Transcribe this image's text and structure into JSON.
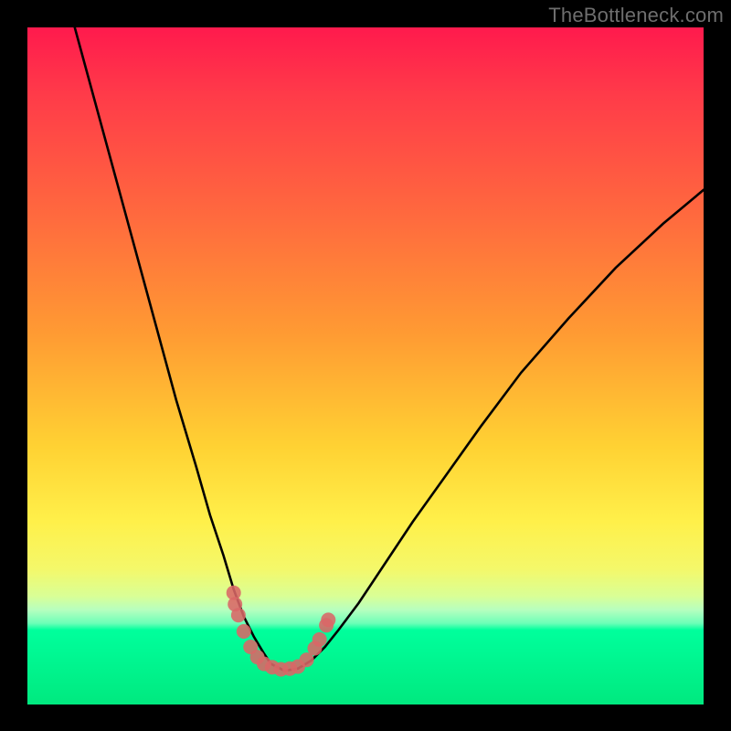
{
  "attribution": "TheBottleneck.com",
  "colors": {
    "frame": "#000000",
    "gradient_top": "#ff1a4d",
    "gradient_mid_orange": "#ff9a33",
    "gradient_yellow": "#fff04a",
    "gradient_green": "#00e97f",
    "curve": "#000000",
    "marker": "#d96666"
  },
  "chart_data": {
    "type": "line",
    "title": "",
    "xlabel": "",
    "ylabel": "",
    "xlim": [
      0,
      100
    ],
    "ylim": [
      0,
      100
    ],
    "series": [
      {
        "name": "curve-left",
        "x": [
          7,
          10,
          13,
          16,
          19,
          22,
          25,
          27,
          29,
          30.5,
          32,
          33.5,
          35,
          36,
          37,
          38
        ],
        "y": [
          100,
          89,
          78,
          67,
          56,
          45,
          35,
          28,
          22,
          17,
          13,
          10,
          7.5,
          6,
          5.5,
          5
        ]
      },
      {
        "name": "curve-right",
        "x": [
          38,
          40,
          42,
          44,
          46,
          49,
          53,
          57,
          62,
          67,
          73,
          80,
          87,
          94,
          100
        ],
        "y": [
          5,
          5.3,
          6.5,
          8.5,
          11,
          15,
          21,
          27,
          34,
          41,
          49,
          57,
          64.5,
          71,
          76
        ]
      }
    ],
    "markers": {
      "name": "bottom-cluster",
      "points": [
        {
          "x": 30.5,
          "y": 16.5
        },
        {
          "x": 30.7,
          "y": 14.8
        },
        {
          "x": 31.2,
          "y": 13.2
        },
        {
          "x": 32.0,
          "y": 10.8
        },
        {
          "x": 33.0,
          "y": 8.5
        },
        {
          "x": 34.0,
          "y": 7.0
        },
        {
          "x": 35.0,
          "y": 6.0
        },
        {
          "x": 36.2,
          "y": 5.5
        },
        {
          "x": 37.5,
          "y": 5.2
        },
        {
          "x": 38.8,
          "y": 5.3
        },
        {
          "x": 40.0,
          "y": 5.6
        },
        {
          "x": 41.3,
          "y": 6.6
        },
        {
          "x": 42.5,
          "y": 8.3
        },
        {
          "x": 43.2,
          "y": 9.6
        },
        {
          "x": 44.2,
          "y": 11.7
        },
        {
          "x": 44.5,
          "y": 12.5
        }
      ]
    }
  }
}
